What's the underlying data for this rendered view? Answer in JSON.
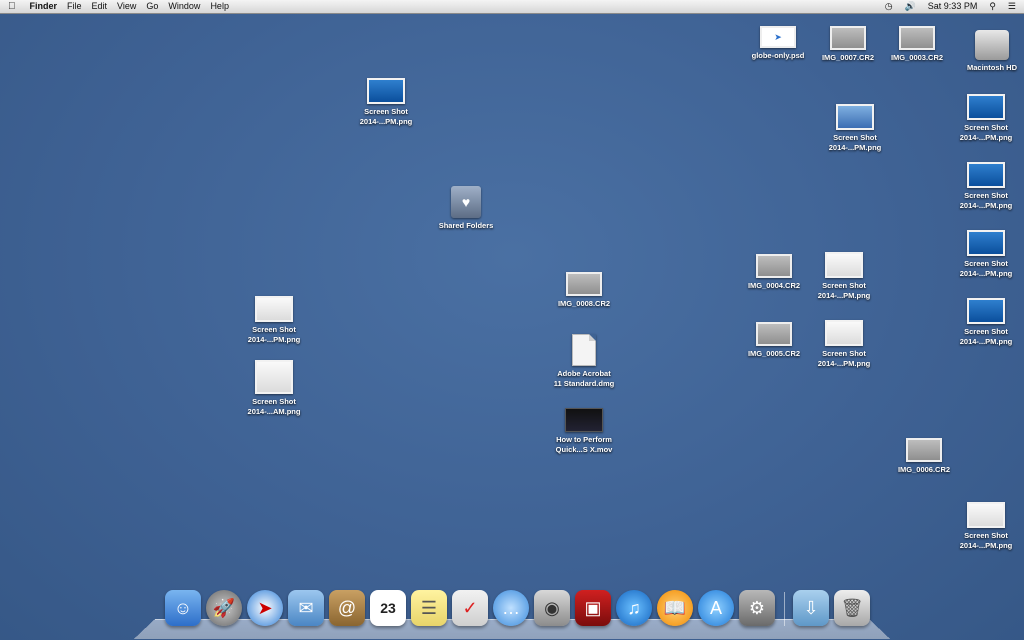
{
  "menubar": {
    "apple": "",
    "app_name": "Finder",
    "menus": [
      "File",
      "Edit",
      "View",
      "Go",
      "Window",
      "Help"
    ],
    "clock": "Sat 9:33 PM"
  },
  "desktop": {
    "icons": [
      {
        "label": "globe-only.psd",
        "kind": "psd"
      },
      {
        "label": "IMG_0007.CR2",
        "kind": "cr2"
      },
      {
        "label": "IMG_0003.CR2",
        "kind": "cr2"
      },
      {
        "label": "Macintosh HD",
        "kind": "hd"
      },
      {
        "label": "Screen Shot\n2014-...PM.png",
        "kind": "shot"
      },
      {
        "label": "Screen Shot\n2014-...PM.png",
        "kind": "shot"
      },
      {
        "label": "Screen Shot\n2014-...PM.png",
        "kind": "shot"
      },
      {
        "label": "Screen Shot\n2014-...PM.png",
        "kind": "shot"
      },
      {
        "label": "Screen Shot\n2014-...PM.png",
        "kind": "shot"
      },
      {
        "label": "Screen Shot\n2014-...PM.png",
        "kind": "shot"
      },
      {
        "label": "Shared Folders",
        "kind": "share"
      },
      {
        "label": "IMG_0008.CR2",
        "kind": "cr2"
      },
      {
        "label": "IMG_0004.CR2",
        "kind": "cr2"
      },
      {
        "label": "Screen Shot\n2014-...PM.png",
        "kind": "shot"
      },
      {
        "label": "IMG_0005.CR2",
        "kind": "cr2"
      },
      {
        "label": "Screen Shot\n2014-...PM.png",
        "kind": "shot"
      },
      {
        "label": "Screen Shot\n2014-...PM.png",
        "kind": "shot"
      },
      {
        "label": "Screen Shot\n2014-...AM.png",
        "kind": "shot"
      },
      {
        "label": "Adobe Acrobat\n11 Standard.dmg",
        "kind": "dmg"
      },
      {
        "label": "How to Perform\nQuick...S X.mov",
        "kind": "mov"
      },
      {
        "label": "IMG_0006.CR2",
        "kind": "cr2"
      },
      {
        "label": "Screen Shot\n2014-...PM.png",
        "kind": "shot"
      }
    ]
  },
  "dock": {
    "items": [
      "finder-icon",
      "launchpad-icon",
      "safari-icon",
      "mail-icon",
      "contacts-icon",
      "calendar-icon",
      "notes-icon",
      "reminders-icon",
      "messages-icon",
      "facetime-icon",
      "photo-booth-icon",
      "itunes-icon",
      "ibooks-icon",
      "app-store-icon",
      "system-preferences-icon",
      "downloads-icon",
      "trash-icon"
    ],
    "calendar_day": "23"
  }
}
